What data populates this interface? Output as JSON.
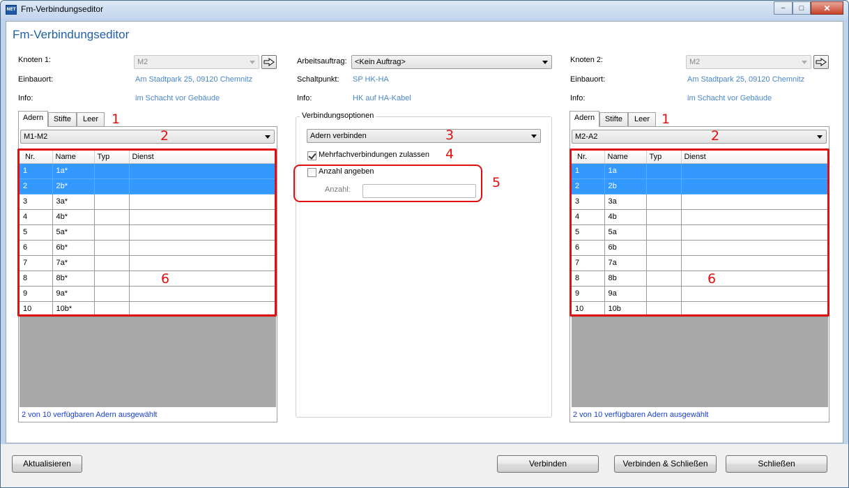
{
  "window": {
    "title": "Fm-Verbindungseditor",
    "icon_text": "NET",
    "minimize": "–",
    "maximize": "□",
    "close": "✕"
  },
  "header": {
    "title": "Fm-Verbindungseditor"
  },
  "left": {
    "knoten_label": "Knoten 1:",
    "knoten_value": "M2",
    "einbauort_label": "Einbauort:",
    "einbauort_value": "Am Stadtpark 25, 09120 Chemnitz",
    "info_label": "Info:",
    "info_value": "im Schacht vor Gebäude",
    "tabs": [
      "Adern",
      "Stifte",
      "Leer"
    ],
    "combo": "M1-M2",
    "columns": [
      "Nr.",
      "Name",
      "Typ",
      "Dienst"
    ],
    "rows": [
      {
        "nr": "1",
        "name": "1a*",
        "typ": "",
        "dienst": "",
        "selected": true
      },
      {
        "nr": "2",
        "name": "2b*",
        "typ": "",
        "dienst": "",
        "selected": true
      },
      {
        "nr": "3",
        "name": "3a*",
        "typ": "",
        "dienst": "",
        "selected": false
      },
      {
        "nr": "4",
        "name": "4b*",
        "typ": "",
        "dienst": "",
        "selected": false
      },
      {
        "nr": "5",
        "name": "5a*",
        "typ": "",
        "dienst": "",
        "selected": false
      },
      {
        "nr": "6",
        "name": "6b*",
        "typ": "",
        "dienst": "",
        "selected": false
      },
      {
        "nr": "7",
        "name": "7a*",
        "typ": "",
        "dienst": "",
        "selected": false
      },
      {
        "nr": "8",
        "name": "8b*",
        "typ": "",
        "dienst": "",
        "selected": false
      },
      {
        "nr": "9",
        "name": "9a*",
        "typ": "",
        "dienst": "",
        "selected": false
      },
      {
        "nr": "10",
        "name": "10b*",
        "typ": "",
        "dienst": "",
        "selected": false
      }
    ],
    "status": "2 von 10 verfügbaren Adern ausgewählt"
  },
  "middle": {
    "arbeitsauftrag_label": "Arbeitsauftrag:",
    "arbeitsauftrag_value": "<Kein Auftrag>",
    "schaltpunkt_label": "Schaltpunkt:",
    "schaltpunkt_value": "SP HK-HA",
    "info_label": "Info:",
    "info_value": "HK auf HA-Kabel",
    "group_label": "Verbindungsoptionen",
    "options_combo": "Adern verbinden",
    "mehrfach_label": "Mehrfachverbindungen zulassen",
    "mehrfach_checked": true,
    "anzahl_angeben_label": "Anzahl angeben",
    "anzahl_angeben_checked": false,
    "anzahl_label": "Anzahl:",
    "anzahl_value": ""
  },
  "right": {
    "knoten_label": "Knoten 2:",
    "knoten_value": "M2",
    "einbauort_label": "Einbauort:",
    "einbauort_value": "Am Stadtpark 25, 09120 Chemnitz",
    "info_label": "Info:",
    "info_value": "im Schacht vor Gebäude",
    "tabs": [
      "Adern",
      "Stifte",
      "Leer"
    ],
    "combo": "M2-A2",
    "columns": [
      "Nr.",
      "Name",
      "Typ",
      "Dienst"
    ],
    "rows": [
      {
        "nr": "1",
        "name": "1a",
        "typ": "",
        "dienst": "",
        "selected": true
      },
      {
        "nr": "2",
        "name": "2b",
        "typ": "",
        "dienst": "",
        "selected": true
      },
      {
        "nr": "3",
        "name": "3a",
        "typ": "",
        "dienst": "",
        "selected": false
      },
      {
        "nr": "4",
        "name": "4b",
        "typ": "",
        "dienst": "",
        "selected": false
      },
      {
        "nr": "5",
        "name": "5a",
        "typ": "",
        "dienst": "",
        "selected": false
      },
      {
        "nr": "6",
        "name": "6b",
        "typ": "",
        "dienst": "",
        "selected": false
      },
      {
        "nr": "7",
        "name": "7a",
        "typ": "",
        "dienst": "",
        "selected": false
      },
      {
        "nr": "8",
        "name": "8b",
        "typ": "",
        "dienst": "",
        "selected": false
      },
      {
        "nr": "9",
        "name": "9a",
        "typ": "",
        "dienst": "",
        "selected": false
      },
      {
        "nr": "10",
        "name": "10b",
        "typ": "",
        "dienst": "",
        "selected": false
      }
    ],
    "status": "2 von 10 verfügbaren Adern ausgewählt"
  },
  "annotations": {
    "n1": "1",
    "n2": "2",
    "n3": "3",
    "n4": "4",
    "n5": "5",
    "n6": "6"
  },
  "footer": {
    "aktualisieren": "Aktualisieren",
    "verbinden": "Verbinden",
    "verbinden_schliessen": "Verbinden & Schließen",
    "schliessen": "Schließen"
  },
  "colors": {
    "accent": "#1f5fa8",
    "link": "#4a86c8",
    "selection": "#3399ff",
    "annotation": "#e01010"
  }
}
